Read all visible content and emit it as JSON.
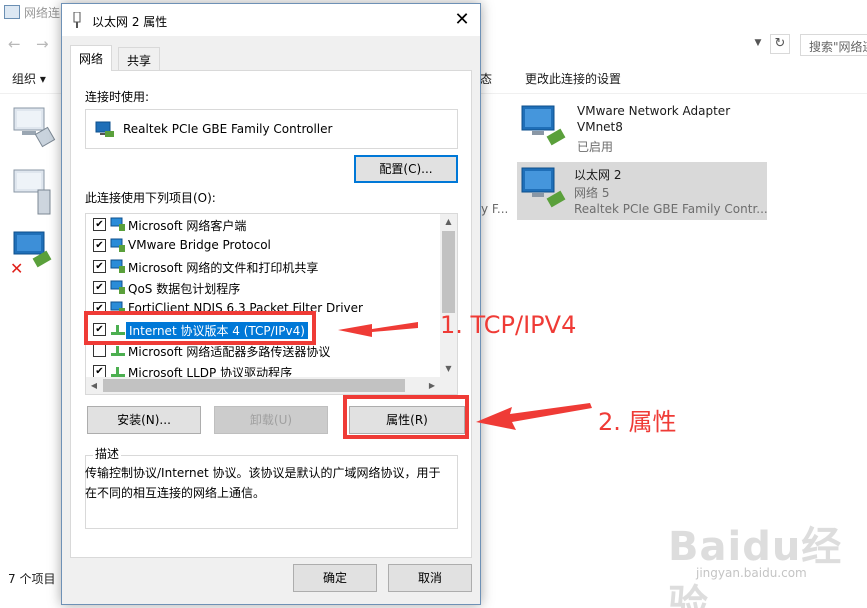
{
  "background": {
    "title": "网络连",
    "search_placeholder": "搜索\"网络连",
    "toolbar": {
      "organize": "组织 ▾",
      "status_fragment": "态",
      "change_settings": "更改此连接的设置"
    },
    "left_fragment": "y F...",
    "items": [
      {
        "name": "VMware Network Adapter",
        "line1": "VMnet8",
        "line2": "已启用",
        "line3": ""
      },
      {
        "name": "以太网 2",
        "line1": "网络  5",
        "line2": "Realtek PCIe GBE Family Contr...",
        "line3": ""
      }
    ],
    "status_bar": "7 个项目"
  },
  "dialog": {
    "title": "以太网 2 属性",
    "close": "✕",
    "tabs": [
      "网络",
      "共享"
    ],
    "connect_using_label": "连接时使用:",
    "adapter_name": "Realtek PCIe GBE Family Controller",
    "configure_button": "配置(C)...",
    "items_label": "此连接使用下列项目(O):",
    "items": [
      {
        "label": "Microsoft 网络客户端",
        "checked": "✔"
      },
      {
        "label": "VMware Bridge Protocol",
        "checked": "✔"
      },
      {
        "label": "Microsoft 网络的文件和打印机共享",
        "checked": "✔"
      },
      {
        "label": "QoS 数据包计划程序",
        "checked": "✔"
      },
      {
        "label": "FortiClient NDIS 6.3 Packet Filter Driver",
        "checked": "✔"
      },
      {
        "label": "Internet 协议版本 4 (TCP/IPv4)",
        "checked": "✔"
      },
      {
        "label": "Microsoft 网络适配器多路传送器协议",
        "checked": ""
      },
      {
        "label": "Microsoft LLDP 协议驱动程序",
        "checked": "✔"
      }
    ],
    "install_button": "安装(N)...",
    "uninstall_button": "卸载(U)",
    "properties_button": "属性(R)",
    "description_legend": "描述",
    "description_text": "传输控制协议/Internet 协议。该协议是默认的广域网络协议，用于在不同的相互连接的网络上通信。",
    "ok_button": "确定",
    "cancel_button": "取消"
  },
  "annotations": {
    "step1": "1. TCP/IPV4",
    "step2": "2. 属性",
    "color": "#ef3b36"
  },
  "watermark": {
    "logo": "Baidu经验",
    "sub": "jingyan.baidu.com"
  }
}
